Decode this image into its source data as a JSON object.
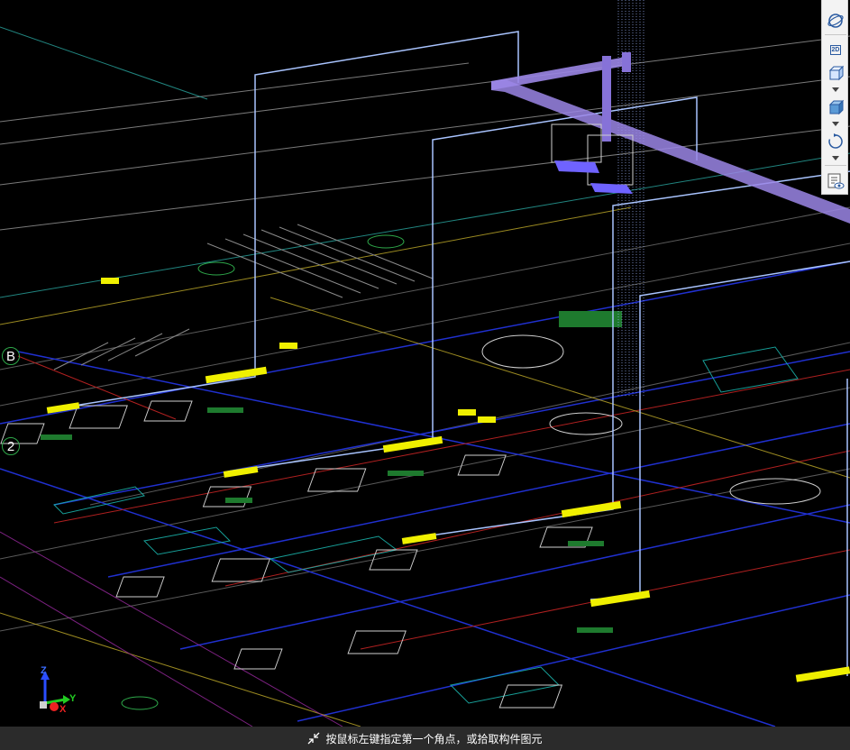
{
  "axis_triad": {
    "z_label": "Z",
    "y_label": "Y",
    "x_label": "X"
  },
  "grid_bubbles": {
    "b": "B",
    "two": "2"
  },
  "toolbar": {
    "items": [
      {
        "name": "orbit",
        "label": ""
      },
      {
        "name": "2d-view",
        "label": "2D"
      },
      {
        "name": "3d-view",
        "label": ""
      },
      {
        "name": "iso-view",
        "label": ""
      },
      {
        "name": "rotate",
        "label": ""
      },
      {
        "name": "display-settings",
        "label": ""
      }
    ]
  },
  "status_bar": {
    "hint": "按鼠标左键指定第一个角点，或拾取构件图元"
  },
  "colors": {
    "background": "#000000",
    "duct": "#9b86e6",
    "riser": "#a9c4ff",
    "fixture": "#f0f000",
    "wall_white": "#cfcfcf",
    "wall_blue": "#2030d0",
    "axis_green": "#2ea84a"
  }
}
